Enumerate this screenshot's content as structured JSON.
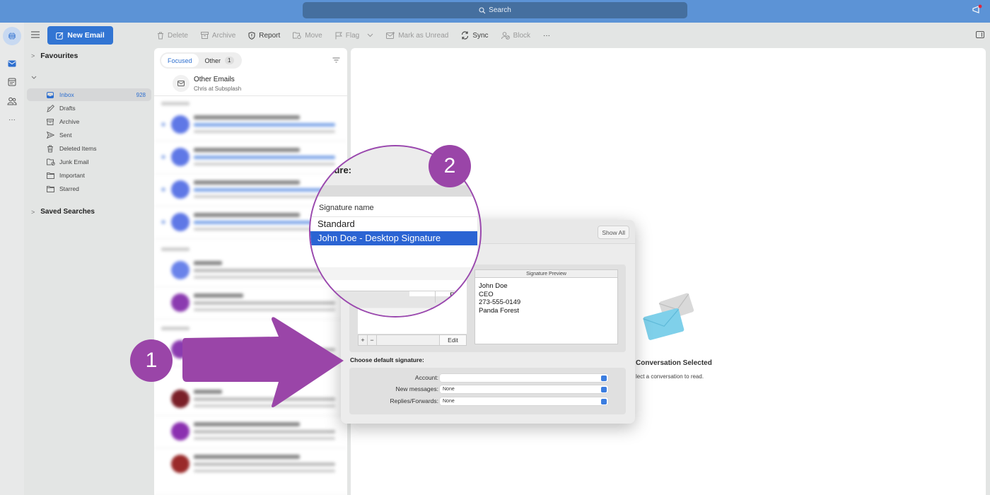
{
  "titlebar": {
    "search_placeholder": "Search",
    "icons": {
      "search": "search-icon",
      "announcements": "megaphone-icon"
    }
  },
  "rail": {
    "items": [
      {
        "name": "globe",
        "icon": "globe-icon",
        "active": true
      },
      {
        "name": "mail",
        "icon": "mail-icon"
      },
      {
        "name": "calendar",
        "icon": "calendar-icon"
      },
      {
        "name": "people",
        "icon": "people-icon"
      },
      {
        "name": "more",
        "icon": "more-icon"
      }
    ]
  },
  "toolbar": {
    "new_email": "New Email",
    "items": [
      {
        "label": "Delete",
        "icon": "trash-icon",
        "enabled": false
      },
      {
        "label": "Archive",
        "icon": "archive-icon",
        "enabled": false
      },
      {
        "label": "Report",
        "icon": "shield-icon",
        "enabled": true
      },
      {
        "label": "Move",
        "icon": "folder-move-icon",
        "enabled": false
      },
      {
        "label": "Flag",
        "icon": "flag-icon",
        "enabled": false
      },
      {
        "label": "Mark as Unread",
        "icon": "envelope-dot-icon",
        "enabled": false
      },
      {
        "label": "Sync",
        "icon": "sync-icon",
        "enabled": true
      },
      {
        "label": "Block",
        "icon": "block-user-icon",
        "enabled": false
      },
      {
        "label": "···",
        "icon": "more-icon",
        "enabled": true
      }
    ]
  },
  "folders": {
    "favourites": "Favourites",
    "saved_searches": "Saved Searches",
    "items": [
      {
        "label": "Inbox",
        "count": "928",
        "icon": "inbox-icon",
        "active": true
      },
      {
        "label": "Drafts",
        "icon": "pencil-icon"
      },
      {
        "label": "Archive",
        "icon": "archive-icon"
      },
      {
        "label": "Sent",
        "icon": "send-icon"
      },
      {
        "label": "Deleted Items",
        "icon": "trash-icon"
      },
      {
        "label": "Junk Email",
        "icon": "junk-icon"
      },
      {
        "label": "Important",
        "icon": "folder-icon"
      },
      {
        "label": "Starred",
        "icon": "folder-icon"
      }
    ]
  },
  "message_list": {
    "tabs": [
      {
        "label": "Focused",
        "active": true
      },
      {
        "label": "Other",
        "badge": "1"
      }
    ],
    "other_emails": {
      "title": "Other Emails",
      "subtitle": "Chris at Subsplash"
    },
    "blurred_avatar_colors": [
      "#5f78e6",
      "#5f78e6",
      "#5f78e6",
      "#5f78e6",
      "#6a83ea",
      "#8b3bb0",
      "#8b3bb0",
      "#7a1f28",
      "#8b30b0",
      "#9a2a2a"
    ]
  },
  "reading_pane": {
    "empty_title": "Conversation Selected",
    "empty_subtitle": "lect a conversation to read."
  },
  "dialog": {
    "show_all": "Show All",
    "preview_header": "Signature Preview",
    "preview_lines": [
      "John Doe",
      "CEO",
      "273-555-0149",
      "Panda Forest"
    ],
    "add": "+",
    "remove": "−",
    "edit": "Edit",
    "choose_default": "Choose default signature:",
    "defaults": [
      {
        "label": "Account:",
        "value": ""
      },
      {
        "label": "New messages:",
        "value": "None"
      },
      {
        "label": "Replies/Forwards:",
        "value": "None"
      }
    ]
  },
  "magnifier": {
    "title": "gnature:",
    "list_header": "Signature name",
    "signatures": [
      {
        "name": "Standard",
        "selected": false
      },
      {
        "name": "John Doe - Desktop Signature",
        "selected": true
      }
    ],
    "remove": "—",
    "edit_fragment": "E"
  },
  "annotations": {
    "step1": "1",
    "step2": "2",
    "color": "#9a45a8"
  }
}
